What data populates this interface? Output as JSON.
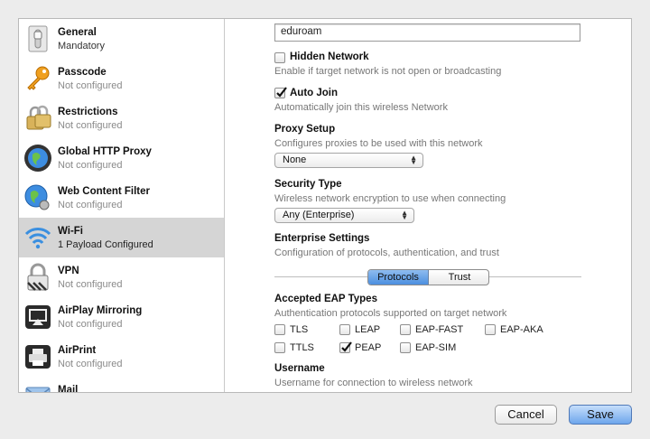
{
  "sidebar": {
    "items": [
      {
        "title": "General",
        "subtitle": "Mandatory",
        "icon": "switch-icon"
      },
      {
        "title": "Passcode",
        "subtitle": "Not configured",
        "icon": "key-icon"
      },
      {
        "title": "Restrictions",
        "subtitle": "Not configured",
        "icon": "padlocks-icon"
      },
      {
        "title": "Global HTTP Proxy",
        "subtitle": "Not configured",
        "icon": "globe-icon"
      },
      {
        "title": "Web Content Filter",
        "subtitle": "Not configured",
        "icon": "globe-filter-icon"
      },
      {
        "title": "Wi-Fi",
        "subtitle": "1 Payload Configured",
        "icon": "wifi-icon"
      },
      {
        "title": "VPN",
        "subtitle": "Not configured",
        "icon": "vpn-lock-icon"
      },
      {
        "title": "AirPlay Mirroring",
        "subtitle": "Not configured",
        "icon": "airplay-icon"
      },
      {
        "title": "AirPrint",
        "subtitle": "Not configured",
        "icon": "printer-icon"
      },
      {
        "title": "Mail",
        "subtitle": "",
        "icon": "mail-icon"
      }
    ],
    "selected_index": 5
  },
  "main": {
    "ssid_value": "eduroam",
    "hidden_network": {
      "label": "Hidden Network",
      "desc": "Enable if target network is not open or broadcasting",
      "checked": false
    },
    "auto_join": {
      "label": "Auto Join",
      "desc": "Automatically join this wireless Network",
      "checked": true
    },
    "proxy_setup": {
      "label": "Proxy Setup",
      "desc": "Configures proxies to be used with this network",
      "value": "None"
    },
    "security_type": {
      "label": "Security Type",
      "desc": "Wireless network encryption to use when connecting",
      "value": "Any (Enterprise)"
    },
    "enterprise": {
      "label": "Enterprise Settings",
      "desc": "Configuration of protocols, authentication, and trust",
      "tabs": [
        "Protocols",
        "Trust"
      ],
      "selected_tab": "Protocols"
    },
    "eap": {
      "label": "Accepted EAP Types",
      "desc": "Authentication protocols supported on target network",
      "types": [
        {
          "name": "TLS",
          "checked": false
        },
        {
          "name": "LEAP",
          "checked": false
        },
        {
          "name": "EAP-FAST",
          "checked": false
        },
        {
          "name": "EAP-AKA",
          "checked": false
        },
        {
          "name": "TTLS",
          "checked": false
        },
        {
          "name": "PEAP",
          "checked": true
        },
        {
          "name": "EAP-SIM",
          "checked": false
        }
      ]
    },
    "username": {
      "label": "Username",
      "desc": "Username for connection to wireless network"
    }
  },
  "buttons": {
    "cancel": "Cancel",
    "save": "Save"
  },
  "colors": {
    "accent": "#4c8fe0",
    "selection": "#d5d5d5"
  }
}
